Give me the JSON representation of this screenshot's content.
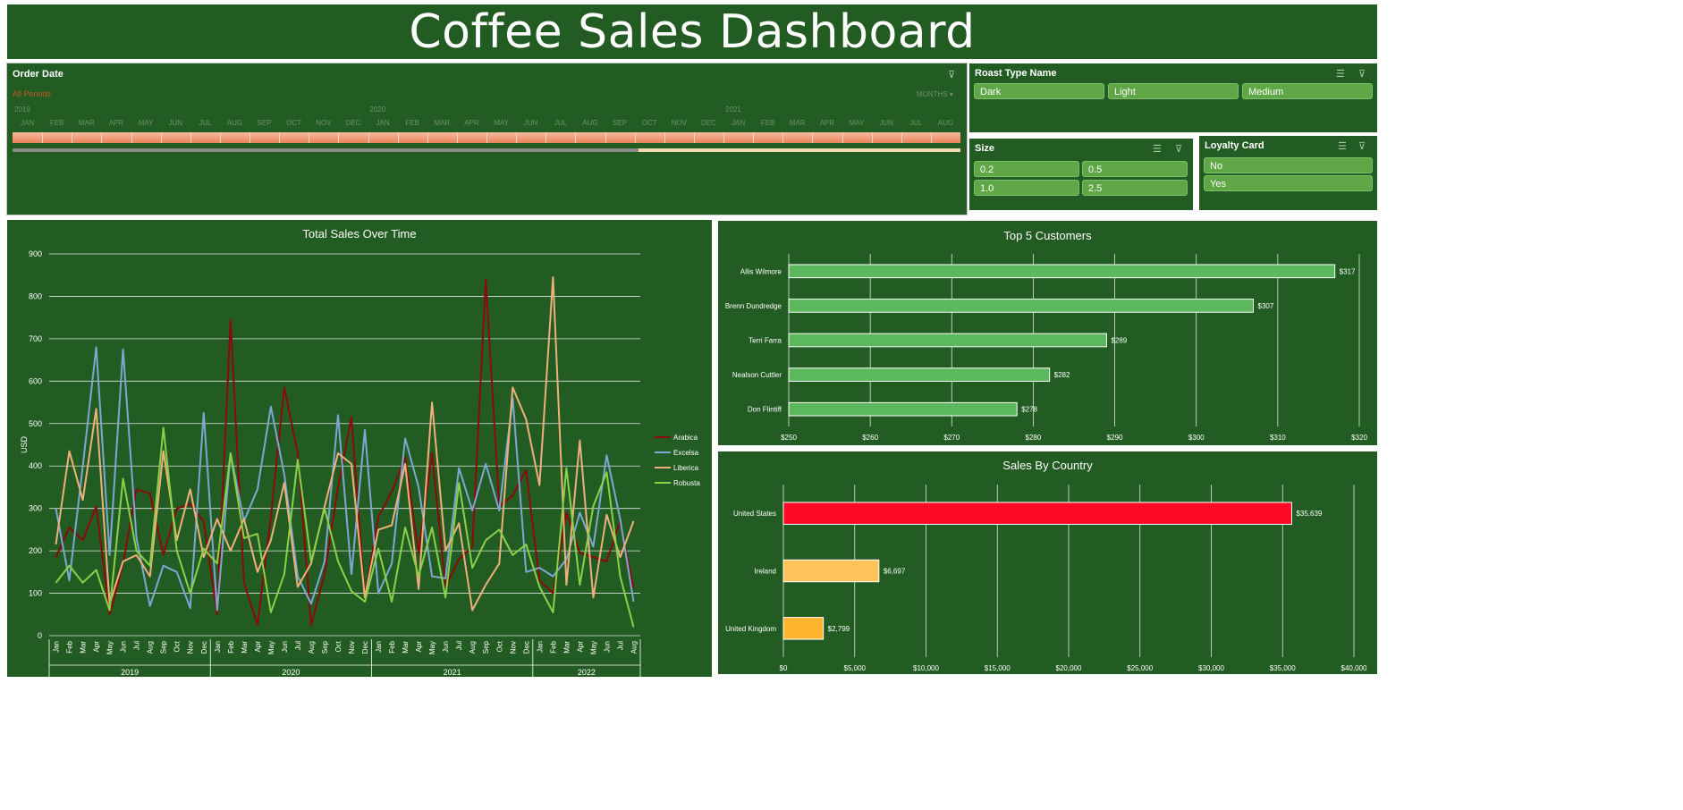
{
  "dashboard": {
    "title": "Coffee Sales Dashboard"
  },
  "timeline": {
    "header": "Order Date",
    "all_periods": "All Periods",
    "level": "MONTHS",
    "years": [
      "2019",
      "2020",
      "2021"
    ],
    "months": [
      "JAN",
      "FEB",
      "MAR",
      "APR",
      "MAY",
      "JUN",
      "JUL",
      "AUG",
      "SEP",
      "OCT",
      "NOV",
      "DEC",
      "JAN",
      "FEB",
      "MAR",
      "APR",
      "MAY",
      "JUN",
      "JUL",
      "AUG",
      "SEP",
      "OCT",
      "NOV",
      "DEC",
      "JAN",
      "FEB",
      "MAR",
      "APR",
      "MAY",
      "JUN",
      "JUL",
      "AUG"
    ],
    "scroll_fraction": 0.66
  },
  "slicers": {
    "roast": {
      "header": "Roast Type Name",
      "items": [
        "Dark",
        "Light",
        "Medium"
      ]
    },
    "size": {
      "header": "Size",
      "items": [
        "0.2",
        "0.5",
        "1.0",
        "2.5"
      ]
    },
    "loyalty": {
      "header": "Loyalty Card",
      "items": [
        "No",
        "Yes"
      ]
    }
  },
  "colors": {
    "panel": "#225c22",
    "arabica": "#8b0b0b",
    "excelsa": "#7fa7d4",
    "liberica": "#efb07c",
    "robusta": "#8ad14a",
    "bar_green": "#5cb85c",
    "us_red": "#ff0a26",
    "ireland_yellow": "#ffc35a",
    "uk_orange": "#ffb52e"
  },
  "chart_data": [
    {
      "type": "line",
      "title": "Total Sales Over Time",
      "ylabel": "USD",
      "xlabel": "",
      "ylim": [
        0,
        900
      ],
      "yticks": [
        0,
        100,
        200,
        300,
        400,
        500,
        600,
        700,
        800,
        900
      ],
      "months": [
        "Jan",
        "Feb",
        "Mar",
        "Apr",
        "May",
        "Jun",
        "Jul",
        "Aug",
        "Sep",
        "Oct",
        "Nov",
        "Dec",
        "Jan",
        "Feb",
        "Mar",
        "Apr",
        "May",
        "Jun",
        "Jul",
        "Aug",
        "Sep",
        "Oct",
        "Nov",
        "Dec",
        "Jan",
        "Feb",
        "Mar",
        "Apr",
        "May",
        "Jun",
        "Jul",
        "Aug",
        "Sep",
        "Oct",
        "Nov",
        "Dec",
        "Jan",
        "Feb",
        "Mar",
        "Apr",
        "May",
        "Jun",
        "Jul",
        "Aug"
      ],
      "years": [
        "2019",
        "2020",
        "2021",
        "2022"
      ],
      "legend_position": "right",
      "series": [
        {
          "name": "Arabica",
          "values": [
            185,
            255,
            225,
            305,
            50,
            170,
            345,
            335,
            190,
            300,
            310,
            270,
            50,
            745,
            125,
            25,
            280,
            585,
            430,
            25,
            145,
            350,
            515,
            90,
            280,
            340,
            420,
            195,
            430,
            115,
            180,
            210,
            840,
            305,
            330,
            390,
            130,
            100,
            290,
            195,
            185,
            175,
            270,
            110
          ]
        },
        {
          "name": "Excelsa",
          "values": [
            300,
            130,
            400,
            680,
            190,
            675,
            230,
            70,
            165,
            150,
            65,
            525,
            60,
            430,
            270,
            345,
            540,
            380,
            140,
            75,
            175,
            520,
            145,
            485,
            100,
            170,
            465,
            350,
            140,
            135,
            395,
            295,
            405,
            295,
            560,
            150,
            160,
            140,
            180,
            290,
            210,
            425,
            275,
            80
          ]
        },
        {
          "name": "Liberica",
          "values": [
            215,
            435,
            320,
            535,
            75,
            175,
            190,
            140,
            435,
            225,
            345,
            185,
            275,
            200,
            275,
            150,
            225,
            360,
            115,
            170,
            305,
            430,
            405,
            90,
            250,
            260,
            405,
            110,
            550,
            200,
            265,
            60,
            120,
            170,
            585,
            510,
            355,
            845,
            120,
            460,
            90,
            285,
            185,
            270
          ]
        },
        {
          "name": "Robusta",
          "values": [
            125,
            165,
            125,
            155,
            60,
            370,
            200,
            165,
            490,
            200,
            100,
            205,
            170,
            430,
            230,
            240,
            55,
            145,
            415,
            175,
            300,
            175,
            105,
            80,
            205,
            80,
            255,
            140,
            255,
            90,
            360,
            160,
            225,
            250,
            190,
            215,
            115,
            55,
            395,
            120,
            305,
            385,
            140,
            20
          ]
        }
      ]
    },
    {
      "type": "bar",
      "title": "Top 5 Customers",
      "categories": [
        "Allis Wilmore",
        "Brenn Dundredge",
        "Terri Farra",
        "Nealson Cuttler",
        "Don Flintiff"
      ],
      "values": [
        317,
        307,
        289,
        282,
        278
      ],
      "data_labels": [
        "$317",
        "$307",
        "$289",
        "$282",
        "$278"
      ],
      "xlim": [
        250,
        320
      ],
      "xticks": [
        "$250",
        "$260",
        "$270",
        "$280",
        "$290",
        "$300",
        "$310",
        "$320"
      ]
    },
    {
      "type": "bar",
      "title": "Sales By Country",
      "categories": [
        "United States",
        "Ireland",
        "United Kingdom"
      ],
      "values": [
        35639,
        6697,
        2799
      ],
      "data_labels": [
        "$35,639",
        "$6,697",
        "$2,799"
      ],
      "xlim": [
        0,
        40000
      ],
      "xticks": [
        "$0",
        "$5,000",
        "$10,000",
        "$15,000",
        "$20,000",
        "$25,000",
        "$30,000",
        "$35,000",
        "$40,000"
      ]
    }
  ]
}
